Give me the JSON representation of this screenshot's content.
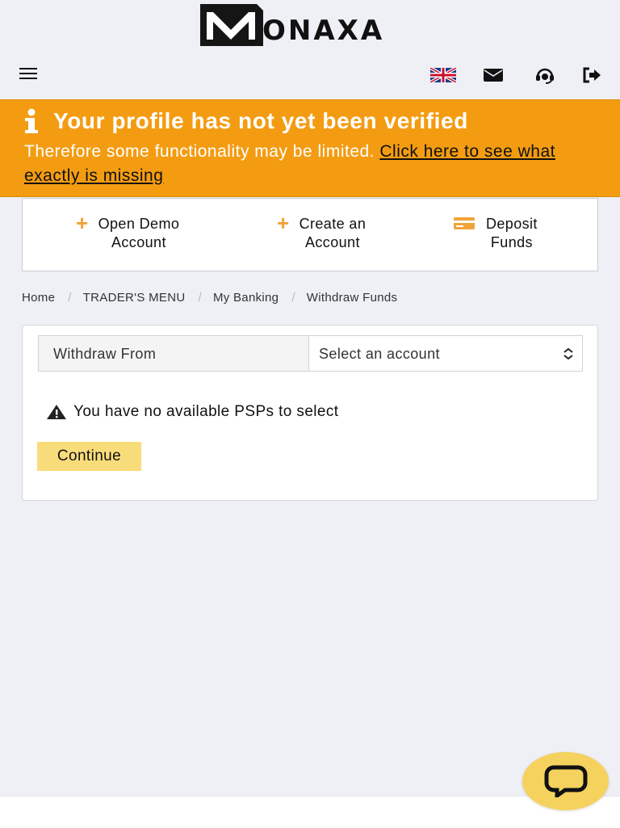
{
  "brand": {
    "name": "ONAXA",
    "logo_letter": "M"
  },
  "header": {
    "icons": [
      "hamburger-menu-icon",
      "uk-flag-icon",
      "envelope-icon",
      "headset-icon",
      "sign-out-icon"
    ]
  },
  "alert": {
    "title": "Your profile has not yet been verified",
    "text": "Therefore some functionality may be limited.",
    "link": "Click here to see what exactly is missing",
    "color": "#f39c12"
  },
  "actions": [
    {
      "line1": "Open Demo",
      "line2": "Account",
      "icon": "plus-icon"
    },
    {
      "line1": "Create an",
      "line2": "Account",
      "icon": "plus-icon"
    },
    {
      "line1": "Deposit",
      "line2": "Funds",
      "icon": "credit-card-icon"
    }
  ],
  "breadcrumb": [
    "Home",
    "TRADER'S MENU",
    "My Banking",
    "Withdraw Funds"
  ],
  "form": {
    "withdraw_from_label": "Withdraw From",
    "account_select": "Select an account",
    "warning": "You have no available PSPs to select",
    "continue_label": "Continue"
  },
  "colors": {
    "accent": "#f0a338",
    "button": "#f9dc7a",
    "chat": "#f5d25e"
  }
}
